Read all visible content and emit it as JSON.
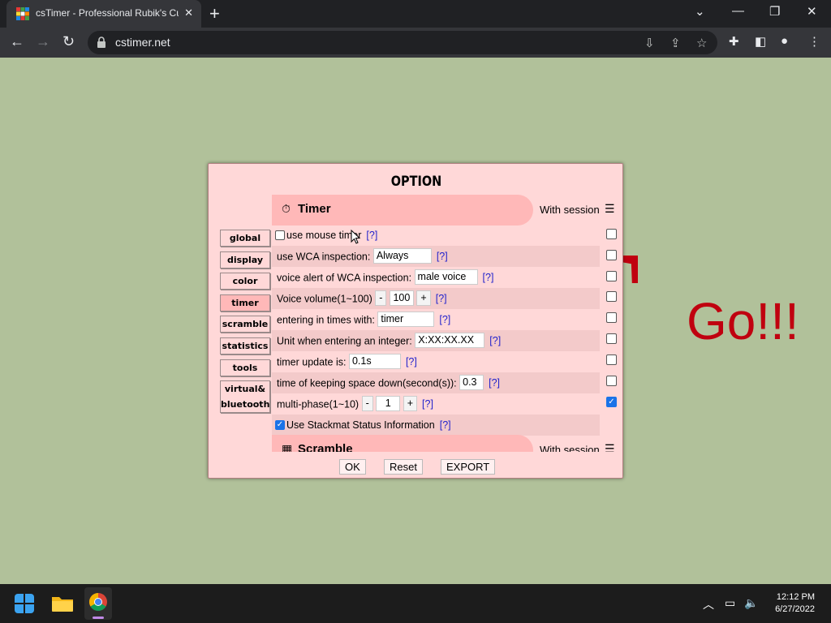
{
  "browser": {
    "tab_title": "csTimer - Professional Rubik's Cube Speedsolving/Training Timer",
    "url": "cstimer.net",
    "new_tab": "+",
    "tab_close": "✕",
    "minimize": "—",
    "restore": "❐",
    "close": "✕"
  },
  "page": {
    "go_text": "Go!!!"
  },
  "dialog": {
    "title": "OPTION",
    "categories": [
      {
        "label": "global"
      },
      {
        "label": "display"
      },
      {
        "label": "color"
      },
      {
        "label": "timer"
      },
      {
        "label": "scramble"
      },
      {
        "label": "statistics"
      },
      {
        "label": "tools"
      },
      {
        "label": "virtual&",
        "label2": "bluetooth"
      }
    ],
    "active_category": "timer",
    "timer_section": {
      "title": "Timer",
      "with_session": "With session",
      "options": {
        "mouse_timer": {
          "label": "use mouse timer",
          "help": "[?]"
        },
        "wca_inspection": {
          "label": "use WCA inspection:",
          "value": "Always",
          "help": "[?]"
        },
        "voice_alert": {
          "label": "voice alert of WCA inspection:",
          "value": "male voice",
          "help": "[?]"
        },
        "voice_volume": {
          "label": "Voice volume(1~100)",
          "minus": "-",
          "value": "100",
          "plus": "+",
          "help": "[?]"
        },
        "entering_times": {
          "label": "entering in times with:",
          "value": "timer",
          "help": "[?]"
        },
        "unit_integer": {
          "label": "Unit when entering an integer:",
          "value": "X:XX:XX.XX",
          "help": "[?]"
        },
        "timer_update": {
          "label": "timer update is:",
          "value": "0.1s",
          "help": "[?]"
        },
        "keep_space": {
          "label": "time of keeping space down(second(s)):",
          "value": "0.3",
          "help": "[?]"
        },
        "multi_phase": {
          "label": "multi-phase(1~10)",
          "minus": "-",
          "value": "1",
          "plus": "+",
          "help": "[?]"
        },
        "stackmat": {
          "label": "Use Stackmat Status Information",
          "help": "[?]"
        }
      }
    },
    "scramble_section": {
      "title": "Scramble",
      "with_session": "With session"
    },
    "buttons": {
      "ok": "OK",
      "reset": "Reset",
      "export": "EXPORT"
    }
  },
  "taskbar": {
    "time": "12:12 PM",
    "date": "6/27/2022"
  },
  "colors": {
    "page_bg": "#b1c19a",
    "dialog_bg": "#ffd8d8",
    "accent_pill": "#ffb8b8",
    "go_red": "#c0000f"
  }
}
